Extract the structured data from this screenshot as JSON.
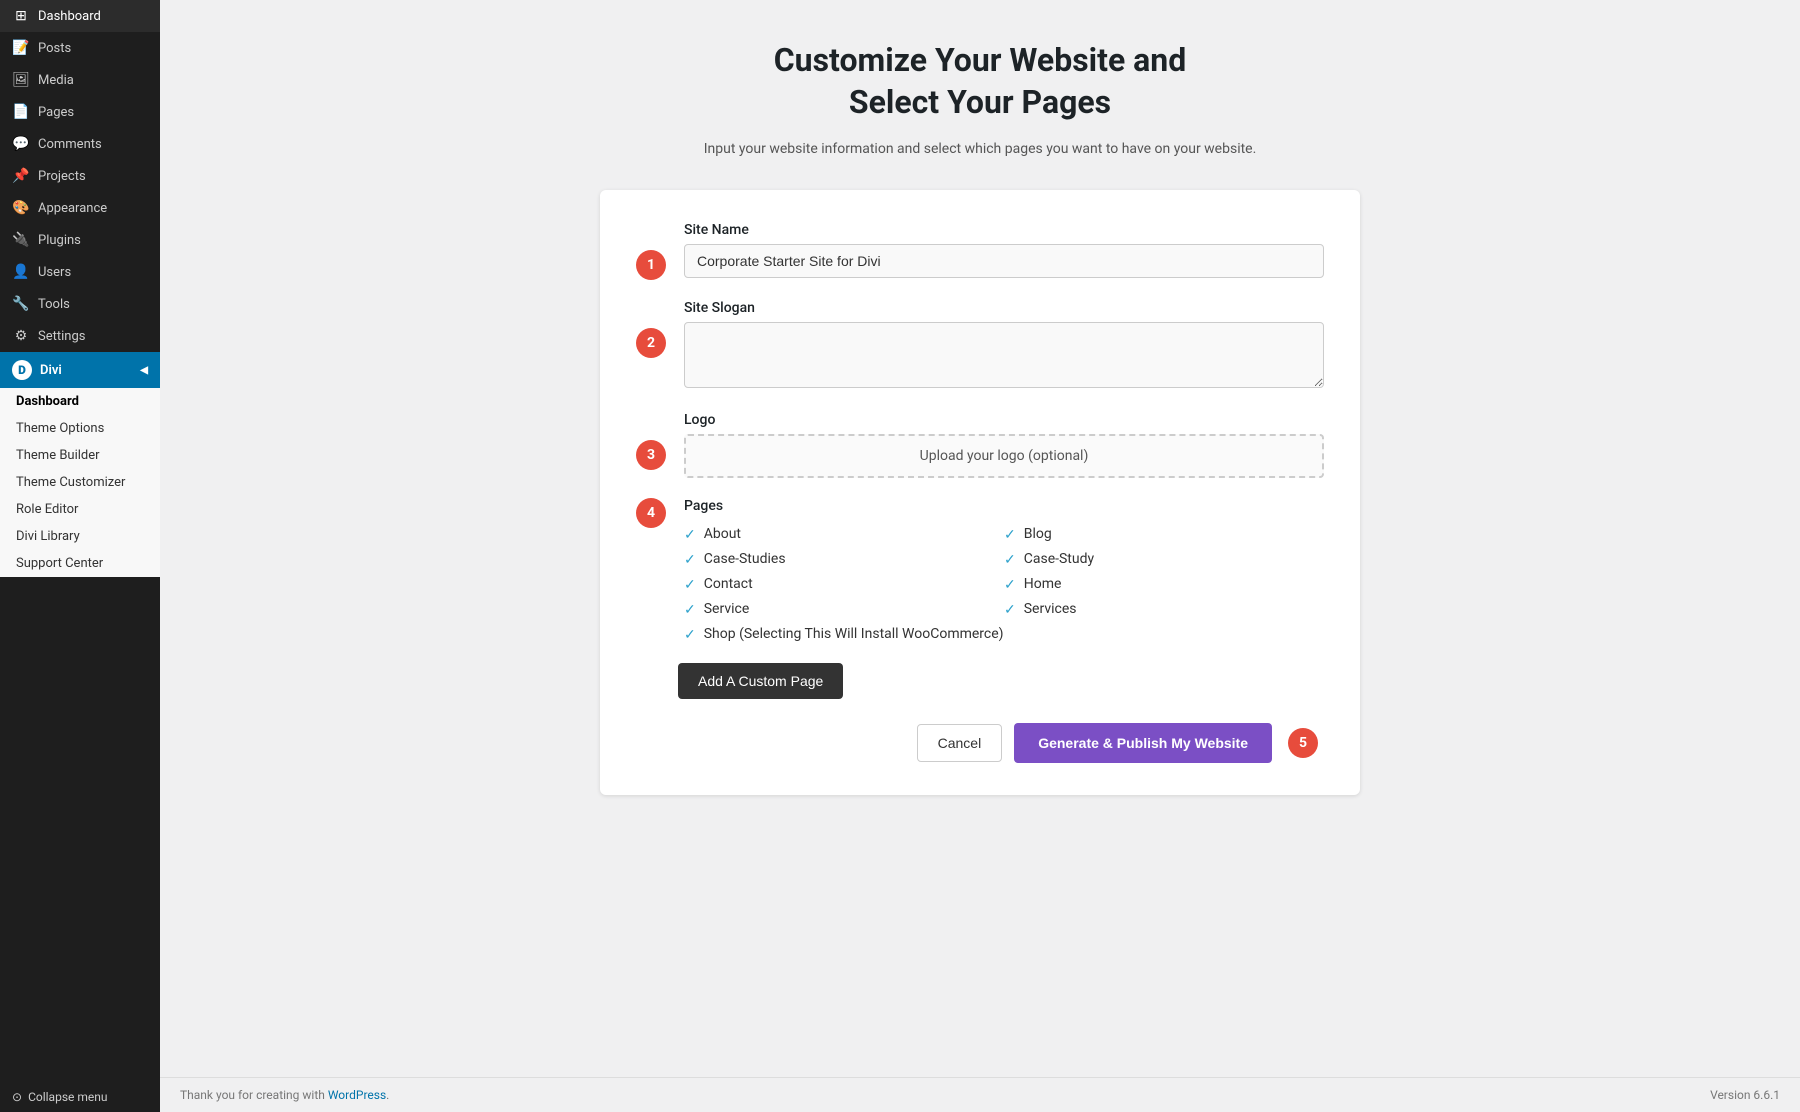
{
  "sidebar": {
    "items": [
      {
        "id": "dashboard",
        "label": "Dashboard",
        "icon": "⊞"
      },
      {
        "id": "posts",
        "label": "Posts",
        "icon": "📝"
      },
      {
        "id": "media",
        "label": "Media",
        "icon": "🖼"
      },
      {
        "id": "pages",
        "label": "Pages",
        "icon": "📄"
      },
      {
        "id": "comments",
        "label": "Comments",
        "icon": "💬"
      },
      {
        "id": "projects",
        "label": "Projects",
        "icon": "📌"
      },
      {
        "id": "appearance",
        "label": "Appearance",
        "icon": "🎨"
      },
      {
        "id": "plugins",
        "label": "Plugins",
        "icon": "🔌"
      },
      {
        "id": "users",
        "label": "Users",
        "icon": "👤"
      },
      {
        "id": "tools",
        "label": "Tools",
        "icon": "🔧"
      },
      {
        "id": "settings",
        "label": "Settings",
        "icon": "⚙"
      }
    ],
    "divi": {
      "label": "Divi",
      "submenu": [
        {
          "id": "dashboard-sub",
          "label": "Dashboard",
          "bold": true
        },
        {
          "id": "theme-options",
          "label": "Theme Options"
        },
        {
          "id": "theme-builder",
          "label": "Theme Builder"
        },
        {
          "id": "theme-customizer",
          "label": "Theme Customizer"
        },
        {
          "id": "role-editor",
          "label": "Role Editor"
        },
        {
          "id": "divi-library",
          "label": "Divi Library"
        },
        {
          "id": "support-center",
          "label": "Support Center"
        }
      ]
    },
    "collapse_label": "Collapse menu"
  },
  "main": {
    "title_line1": "Customize Your Website and",
    "title_line2": "Select Your Pages",
    "subtitle": "Input your website information and select which pages you want to have on your website.",
    "steps": [
      {
        "number": "1"
      },
      {
        "number": "2"
      },
      {
        "number": "3"
      },
      {
        "number": "4"
      },
      {
        "number": "5"
      }
    ],
    "form": {
      "site_name_label": "Site Name",
      "site_name_value": "Corporate Starter Site for Divi",
      "site_slogan_label": "Site Slogan",
      "site_slogan_value": "",
      "logo_label": "Logo",
      "logo_upload_text": "Upload your logo (optional)",
      "pages_label": "Pages",
      "pages_left": [
        {
          "label": "About",
          "checked": true
        },
        {
          "label": "Case-Studies",
          "checked": true
        },
        {
          "label": "Contact",
          "checked": true
        },
        {
          "label": "Service",
          "checked": true
        },
        {
          "label": "Shop (Selecting This Will Install WooCommerce)",
          "checked": true
        }
      ],
      "pages_right": [
        {
          "label": "Blog",
          "checked": true
        },
        {
          "label": "Case-Study",
          "checked": true
        },
        {
          "label": "Home",
          "checked": true
        },
        {
          "label": "Services",
          "checked": true
        }
      ],
      "add_custom_page_label": "Add A Custom Page",
      "cancel_label": "Cancel",
      "publish_label": "Generate & Publish My Website"
    }
  },
  "footer": {
    "left_text": "Thank you for creating with",
    "link_text": "WordPress",
    "right_text": "Version 6.6.1"
  }
}
